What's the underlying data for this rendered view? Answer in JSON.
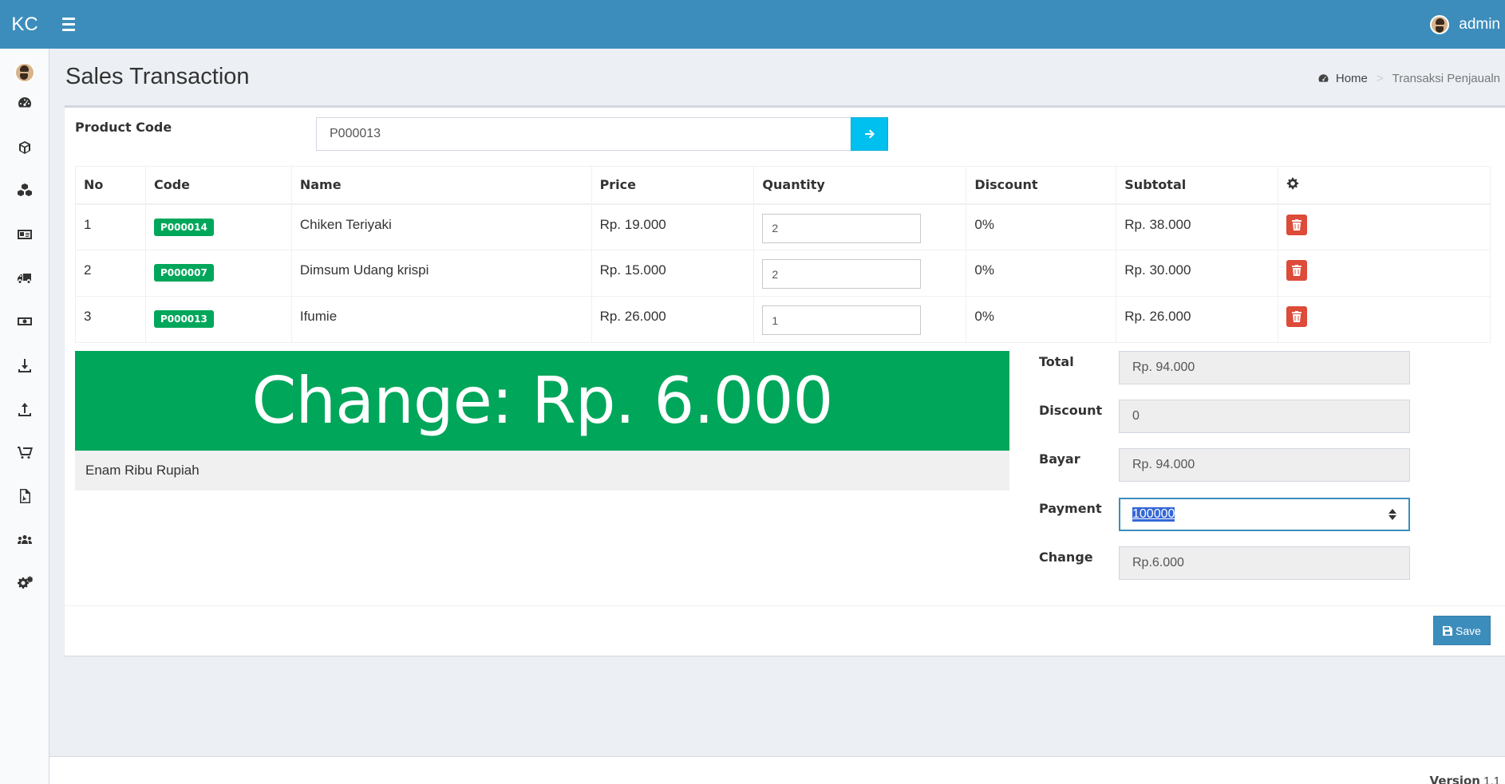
{
  "header": {
    "logo": "KC",
    "username": "admin"
  },
  "sidebar": {
    "items": [
      {
        "icon": "dashboard-icon"
      },
      {
        "icon": "cube-icon"
      },
      {
        "icon": "cubes-icon"
      },
      {
        "icon": "id-card-icon"
      },
      {
        "icon": "truck-icon"
      },
      {
        "icon": "money-icon"
      },
      {
        "icon": "download-icon"
      },
      {
        "icon": "upload-icon"
      },
      {
        "icon": "cart-icon"
      },
      {
        "icon": "pdf-file-icon"
      },
      {
        "icon": "users-icon"
      },
      {
        "icon": "cogs-icon"
      }
    ]
  },
  "page": {
    "title": "Sales Transaction",
    "breadcrumb": {
      "home": "Home",
      "separator": ">",
      "current": "Transaksi Penjaualn"
    }
  },
  "form": {
    "product_code_label": "Product Code",
    "product_code_value": "P000013"
  },
  "table": {
    "headers": [
      "No",
      "Code",
      "Name",
      "Price",
      "Quantity",
      "Discount",
      "Subtotal"
    ],
    "rows": [
      {
        "no": "1",
        "code": "P000014",
        "name": "Chiken Teriyaki",
        "price": "Rp. 19.000",
        "qty": "2",
        "discount": "0%",
        "subtotal": "Rp. 38.000"
      },
      {
        "no": "2",
        "code": "P000007",
        "name": "Dimsum Udang krispi",
        "price": "Rp. 15.000",
        "qty": "2",
        "discount": "0%",
        "subtotal": "Rp. 30.000"
      },
      {
        "no": "3",
        "code": "P000013",
        "name": "Ifumie",
        "price": "Rp. 26.000",
        "qty": "1",
        "discount": "0%",
        "subtotal": "Rp. 26.000"
      }
    ]
  },
  "change_banner": {
    "text": "Change: Rp. 6.000",
    "in_words": "Enam Ribu Rupiah"
  },
  "totals": {
    "total_label": "Total",
    "total_value": "Rp. 94.000",
    "discount_label": "Discount",
    "discount_value": "0",
    "bayar_label": "Bayar",
    "bayar_value": "Rp. 94.000",
    "payment_label": "Payment",
    "payment_value": "100000",
    "change_label": "Change",
    "change_value": "Rp.6.000"
  },
  "actions": {
    "save_label": "Save"
  },
  "footer": {
    "version_label": "Version",
    "version_value": "1.1"
  },
  "colors": {
    "header": "#3c8dbc",
    "success": "#00a65a",
    "danger": "#dd4b39",
    "info": "#00c0ef"
  }
}
